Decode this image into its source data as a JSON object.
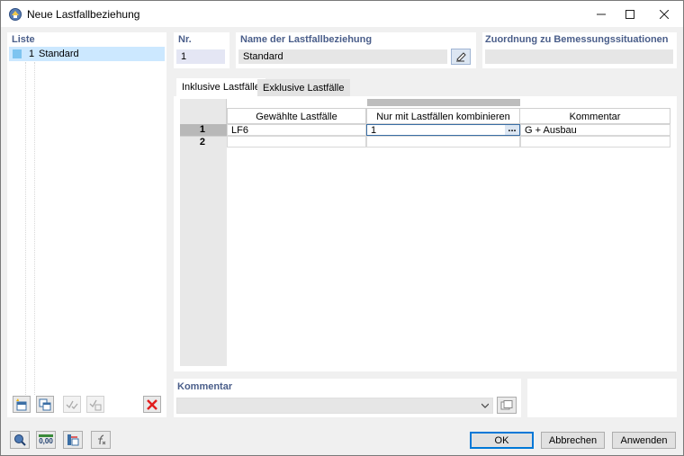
{
  "window": {
    "title": "Neue Lastfallbeziehung"
  },
  "list": {
    "label": "Liste",
    "items": [
      {
        "nr": "1",
        "name": "Standard",
        "color": "#7ec4f0"
      }
    ]
  },
  "nr": {
    "label": "Nr.",
    "value": "1"
  },
  "name": {
    "label": "Name der Lastfallbeziehung",
    "value": "Standard"
  },
  "assignment": {
    "label": "Zuordnung zu Bemessungssituationen",
    "value": ""
  },
  "tabs": [
    {
      "label": "Inklusive Lastfälle",
      "active": true
    },
    {
      "label": "Exklusive Lastfälle",
      "active": false
    }
  ],
  "grid": {
    "columns": [
      "Gewählte Lastfälle",
      "Nur mit Lastfällen kombinieren",
      "Kommentar"
    ],
    "rows": [
      {
        "nr": "1",
        "cells": [
          "LF6",
          "1",
          "G + Ausbau"
        ]
      },
      {
        "nr": "2",
        "cells": [
          "",
          "",
          ""
        ]
      }
    ],
    "ellipsis": "..."
  },
  "comment": {
    "label": "Kommentar",
    "value": ""
  },
  "buttons": {
    "ok": "OK",
    "cancel": "Abbrechen",
    "apply": "Anwenden"
  },
  "bottom_tools": {
    "units_label": "0,00"
  }
}
